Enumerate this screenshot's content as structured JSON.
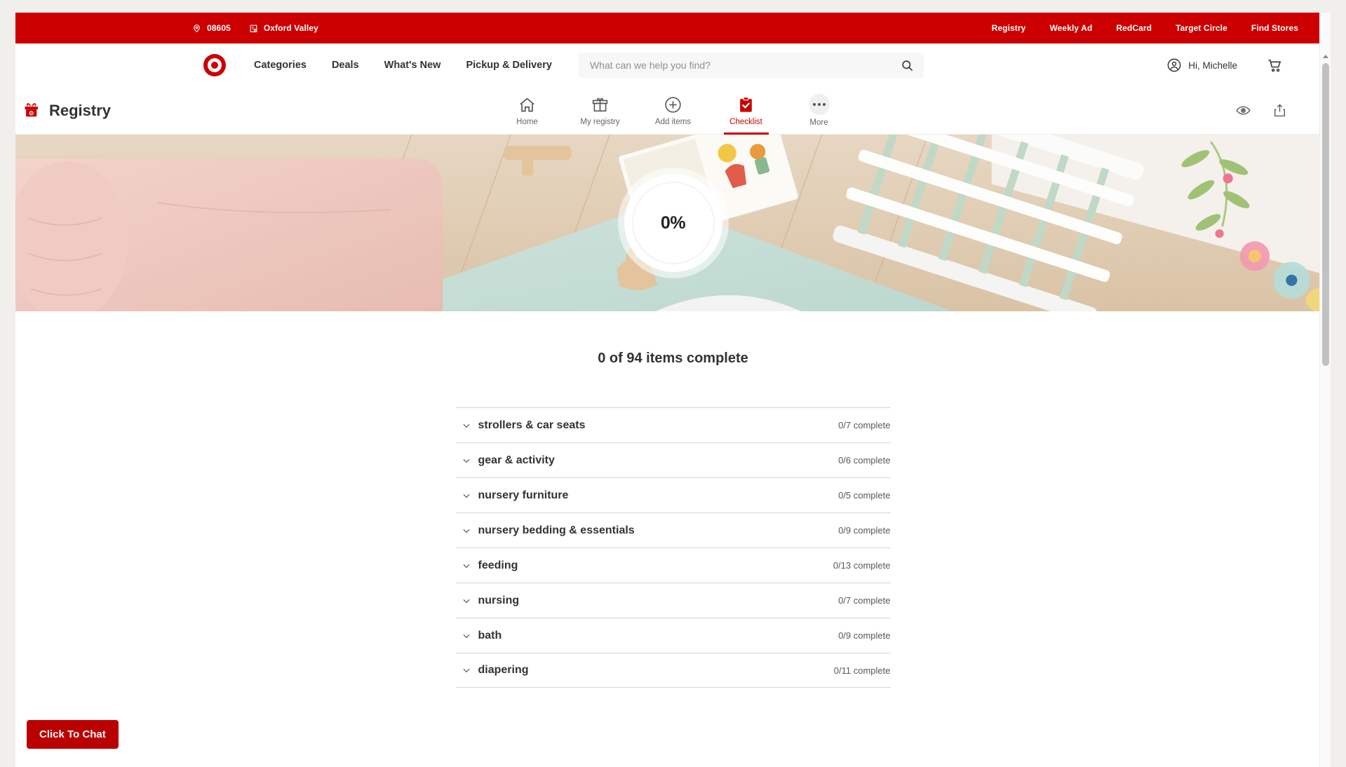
{
  "utility_bar": {
    "zip_icon": "location-pin-icon",
    "zip": "08605",
    "store_icon": "store-icon",
    "store": "Oxford Valley",
    "links": [
      {
        "label": "Registry"
      },
      {
        "label": "Weekly Ad"
      },
      {
        "label": "RedCard"
      },
      {
        "label": "Target Circle"
      },
      {
        "label": "Find Stores"
      }
    ]
  },
  "header": {
    "logo": "target-bullseye-logo",
    "nav": [
      {
        "label": "Categories"
      },
      {
        "label": "Deals"
      },
      {
        "label": "What's New"
      },
      {
        "label": "Pickup & Delivery"
      }
    ],
    "search": {
      "placeholder": "What can we help you find?",
      "value": "",
      "icon": "search-icon"
    },
    "account": {
      "icon": "account-circle-icon",
      "label": "Hi, Michelle"
    },
    "cart_icon": "shopping-cart-icon"
  },
  "registry_bar": {
    "brand_icon": "gift-box-icon",
    "brand_title": "Registry",
    "tabs": [
      {
        "label": "Home",
        "icon": "home-icon",
        "active": false
      },
      {
        "label": "My registry",
        "icon": "gift-icon",
        "active": false
      },
      {
        "label": "Add items",
        "icon": "plus-circle-icon",
        "active": false
      },
      {
        "label": "Checklist",
        "icon": "clipboard-check-icon",
        "active": true
      },
      {
        "label": "More",
        "icon": "ellipsis-icon",
        "active": false
      }
    ],
    "preview_icon": "eye-icon",
    "share_icon": "share-icon"
  },
  "hero": {
    "progress_percent": "0%"
  },
  "checklist": {
    "heading": "0 of 94 items complete",
    "rows": [
      {
        "label": "strollers & car seats",
        "count": "0/7 complete"
      },
      {
        "label": "gear & activity",
        "count": "0/6 complete"
      },
      {
        "label": "nursery furniture",
        "count": "0/5 complete"
      },
      {
        "label": "nursery bedding & essentials",
        "count": "0/9 complete"
      },
      {
        "label": "feeding",
        "count": "0/13 complete"
      },
      {
        "label": "nursing",
        "count": "0/7 complete"
      },
      {
        "label": "bath",
        "count": "0/9 complete"
      },
      {
        "label": "diapering",
        "count": "0/11 complete"
      }
    ]
  },
  "chat": {
    "label": "Click To Chat"
  },
  "colors": {
    "brand_red": "#cc0000",
    "chat_red": "#bb0000",
    "text_dark": "#333333"
  }
}
